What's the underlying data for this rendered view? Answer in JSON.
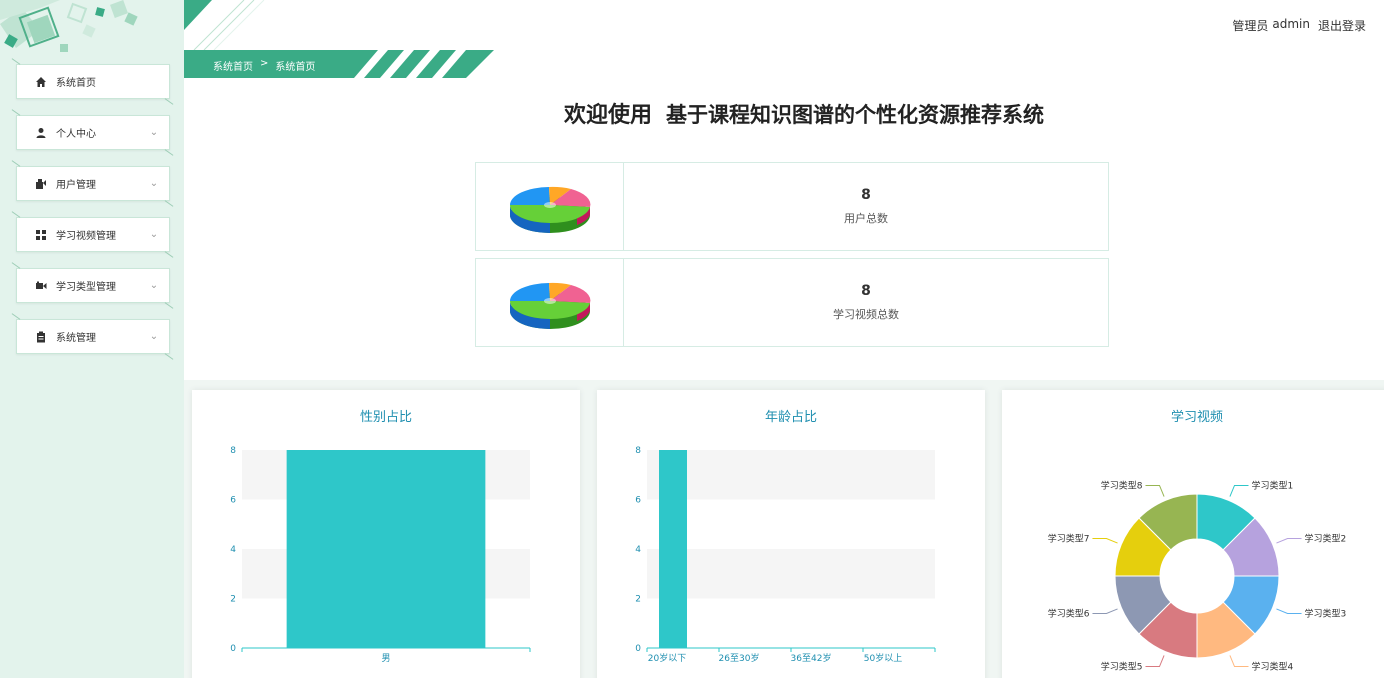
{
  "header": {
    "role_label": "管理员",
    "username": "admin",
    "logout_label": "退出登录"
  },
  "breadcrumb": {
    "items": [
      "系统首页",
      "系统首页"
    ],
    "separator": ">"
  },
  "welcome": {
    "prefix": "欢迎使用",
    "system_name": "基于课程知识图谱的个性化资源推荐系统"
  },
  "sidebar": {
    "items": [
      {
        "label": "系统首页",
        "icon": "home-icon",
        "expandable": false
      },
      {
        "label": "个人中心",
        "icon": "user-icon",
        "expandable": true
      },
      {
        "label": "用户管理",
        "icon": "users-icon",
        "expandable": true
      },
      {
        "label": "学习视频管理",
        "icon": "grid-icon",
        "expandable": true
      },
      {
        "label": "学习类型管理",
        "icon": "video-icon",
        "expandable": true
      },
      {
        "label": "系统管理",
        "icon": "clipboard-icon",
        "expandable": true
      }
    ]
  },
  "stats": [
    {
      "value": "8",
      "label": "用户总数"
    },
    {
      "value": "8",
      "label": "学习视频总数"
    }
  ],
  "colors": {
    "accent": "#3aab86",
    "bar": "#2ec7c9",
    "title": "#1f8fb0"
  },
  "chart_data": [
    {
      "type": "bar",
      "title": "性别占比",
      "categories": [
        "男"
      ],
      "values": [
        8
      ],
      "ylim": [
        0,
        8
      ],
      "yticks": [
        "0",
        "2",
        "4",
        "6",
        "8"
      ]
    },
    {
      "type": "bar",
      "title": "年龄占比",
      "categories": [
        "20岁以下",
        "26至30岁",
        "36至42岁",
        "50岁以上"
      ],
      "values": [
        8,
        0,
        0,
        0
      ],
      "ylim": [
        0,
        8
      ],
      "yticks": [
        "0",
        "2",
        "4",
        "6",
        "8"
      ]
    },
    {
      "type": "pie",
      "title": "学习视频",
      "categories": [
        "学习类型1",
        "学习类型2",
        "学习类型3",
        "学习类型4",
        "学习类型5",
        "学习类型6",
        "学习类型7",
        "学习类型8"
      ],
      "values": [
        1,
        1,
        1,
        1,
        1,
        1,
        1,
        1
      ],
      "colors": [
        "#2ec7c9",
        "#b6a2de",
        "#5ab1ef",
        "#ffb980",
        "#d87a80",
        "#8d98b3",
        "#e5cf0d",
        "#97b552"
      ]
    }
  ]
}
